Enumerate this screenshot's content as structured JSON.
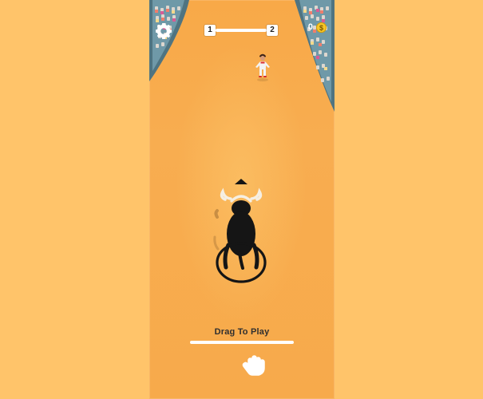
{
  "hud": {
    "level_start": "1",
    "level_end": "2",
    "progress": 0,
    "coin_count": "0",
    "coin_symbol": "$"
  },
  "prompt": {
    "drag_label": "Drag To Play"
  },
  "icons": {
    "settings": "gear-icon",
    "coin": "coin-icon",
    "hand": "hand-pointer-icon",
    "bull": "bull-icon",
    "matador": "matador-icon"
  },
  "colors": {
    "background": "#ffc46a",
    "arena": "#f8ad50",
    "hud_white": "#ffffff",
    "bull_black": "#151515",
    "horn_cream": "#f6efe2",
    "coin_gold": "#f6c629"
  }
}
